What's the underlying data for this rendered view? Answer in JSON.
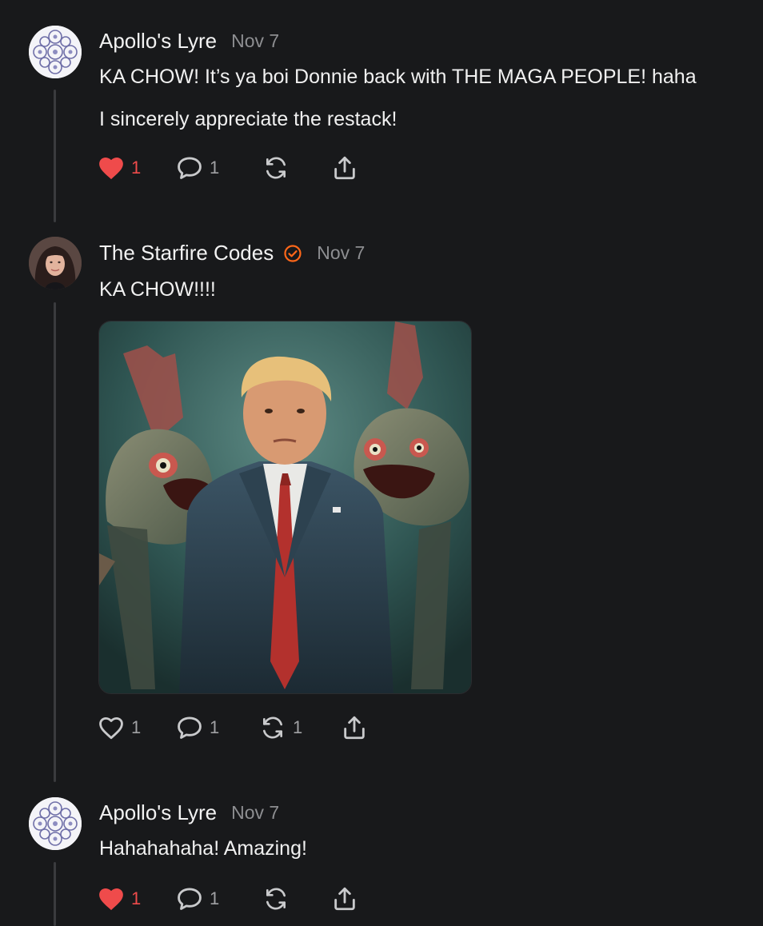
{
  "posts": [
    {
      "author": "Apollo's Lyre",
      "date": "Nov 7",
      "lines": [
        "KA CHOW! It’s ya boi Donnie back with THE MAGA PEOPLE! haha",
        "I sincerely appreciate the restack!"
      ],
      "likes": "1",
      "liked": true,
      "comments": "1",
      "restacks": "",
      "icons": [
        "heart-icon",
        "comment-icon",
        "restack-icon",
        "share-icon"
      ]
    },
    {
      "author": "The Starfire Codes",
      "verified": true,
      "date": "Nov 7",
      "lines": [
        "KA CHOW!!!!"
      ],
      "image": "Man in suit and red striped tie standing between two large fish creatures",
      "likes": "1",
      "liked": false,
      "comments": "1",
      "restacks": "1",
      "icons": [
        "heart-icon",
        "comment-icon",
        "restack-icon",
        "share-icon"
      ]
    },
    {
      "author": "Apollo's Lyre",
      "date": "Nov 7",
      "lines": [
        "Hahahahaha! Amazing!"
      ],
      "likes": "1",
      "liked": true,
      "comments": "1",
      "restacks": "",
      "icons": [
        "heart-icon",
        "comment-icon",
        "restack-icon",
        "share-icon"
      ]
    }
  ],
  "colors": {
    "background": "#18191b",
    "liked": "#ef4b4b",
    "verified": "#ff6719",
    "muted": "#8d8e91"
  }
}
